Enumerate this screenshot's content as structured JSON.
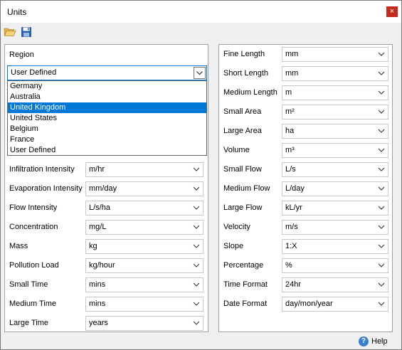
{
  "window": {
    "title": "Units",
    "close_glyph": "×"
  },
  "toolbar": {
    "open_icon": "folder-open-icon",
    "save_icon": "floppy-disk-icon"
  },
  "region": {
    "label": "Region",
    "value": "User Defined",
    "options": [
      "Germany",
      "Australia",
      "United Kingdom",
      "United States",
      "Belgium",
      "France",
      "User Defined"
    ],
    "highlighted": "United Kingdom"
  },
  "left_rows": [
    {
      "label": "Infiltration Intensity",
      "value": "m/hr"
    },
    {
      "label": "Evaporation Intensity",
      "value": "mm/day"
    },
    {
      "label": "Flow Intensity",
      "value": "L/s/ha"
    },
    {
      "label": "Concentration",
      "value": "mg/L"
    },
    {
      "label": "Mass",
      "value": "kg"
    },
    {
      "label": "Pollution Load",
      "value": "kg/hour"
    },
    {
      "label": "Small Time",
      "value": "mins"
    },
    {
      "label": "Medium Time",
      "value": "mins"
    },
    {
      "label": "Large Time",
      "value": "years"
    }
  ],
  "right_rows": [
    {
      "label": "Fine Length",
      "value": "mm"
    },
    {
      "label": "Short Length",
      "value": "mm"
    },
    {
      "label": "Medium Length",
      "value": "m"
    },
    {
      "label": "Small Area",
      "value": "m²"
    },
    {
      "label": "Large Area",
      "value": "ha"
    },
    {
      "label": "Volume",
      "value": "m³"
    },
    {
      "label": "Small Flow",
      "value": "L/s"
    },
    {
      "label": "Medium Flow",
      "value": "L/day"
    },
    {
      "label": "Large Flow",
      "value": "kL/yr"
    },
    {
      "label": "Velocity",
      "value": "m/s"
    },
    {
      "label": "Slope",
      "value": "1:X"
    },
    {
      "label": "Percentage",
      "value": "%"
    },
    {
      "label": "Time Format",
      "value": "24hr"
    },
    {
      "label": "Date Format",
      "value": "day/mon/year"
    }
  ],
  "footer": {
    "help_label": "Help",
    "help_glyph": "?"
  },
  "colors": {
    "accent": "#0078d7",
    "close": "#c42b1c",
    "help": "#3a7fcf"
  }
}
